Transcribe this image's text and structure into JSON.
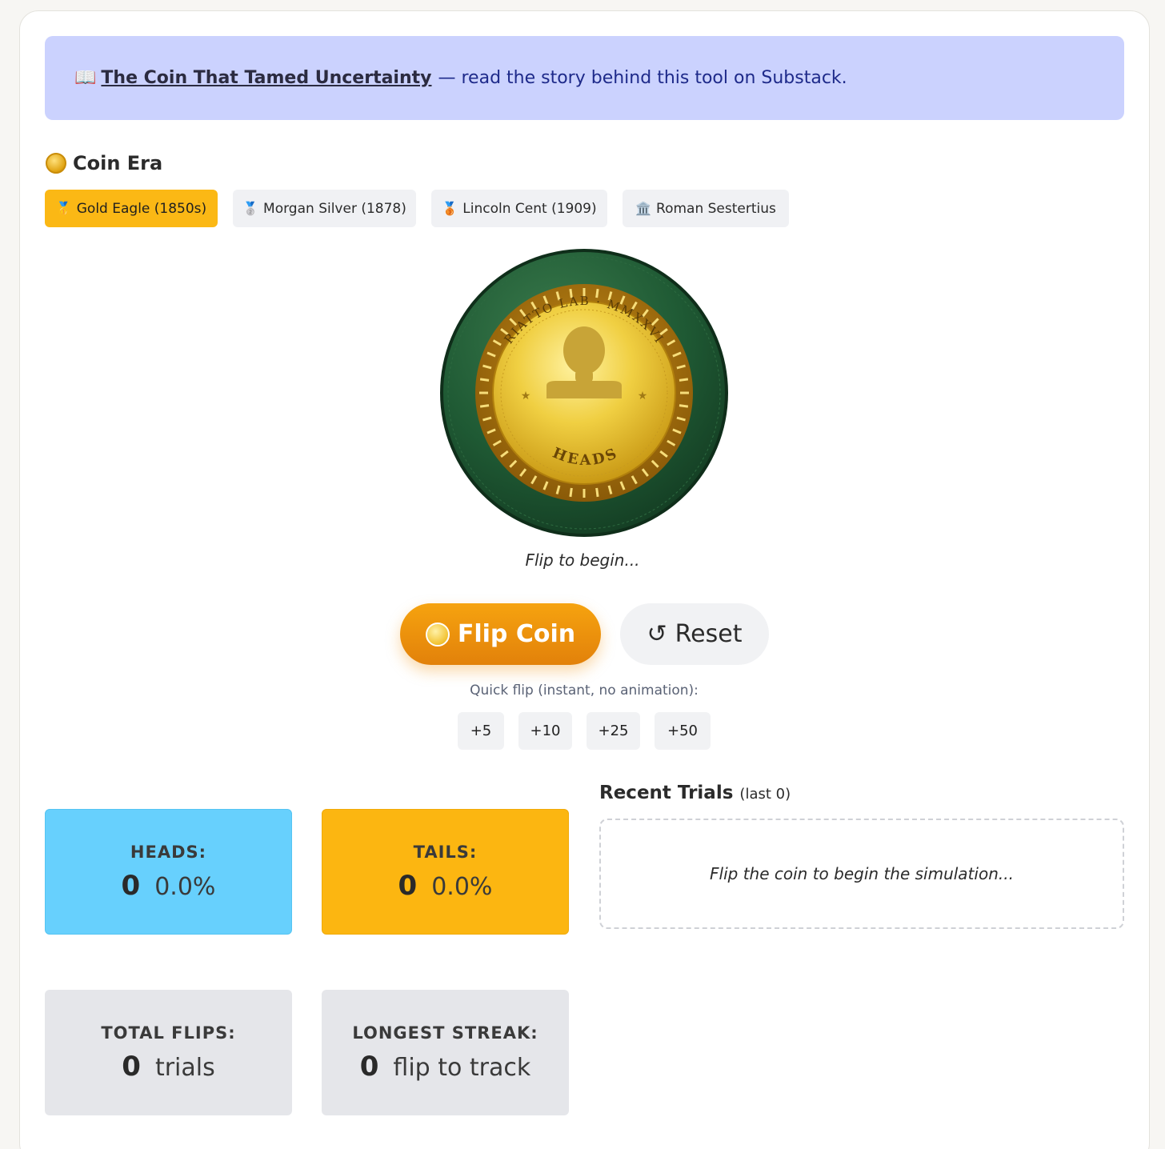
{
  "banner": {
    "book_icon": "📖",
    "link_text": "The Coin That Tamed Uncertainty",
    "rest_text": "— read the story behind this tool on Substack."
  },
  "era": {
    "title": "Coin Era",
    "options": [
      {
        "label": "Gold Eagle (1850s)",
        "medal": "🥇",
        "active": true
      },
      {
        "label": "Morgan Silver (1878)",
        "medal": "🥈",
        "active": false
      },
      {
        "label": "Lincoln Cent (1909)",
        "medal": "🥉",
        "active": false
      },
      {
        "label": "Roman Sestertius",
        "medal": "🏛️",
        "active": false
      }
    ]
  },
  "coin": {
    "rim_text": "RIATTO LAB · MMXXVI",
    "face_text": "HEADS",
    "caption": "Flip to begin...",
    "colors": {
      "felt": "#1f5a34",
      "gold": "#e6c23a",
      "rim": "#9c6a0c"
    }
  },
  "controls": {
    "flip_label": "Flip Coin",
    "reset_icon": "↺",
    "reset_label": "Reset",
    "quick_label": "Quick flip (instant, no animation):",
    "quick": [
      "+5",
      "+10",
      "+25",
      "+50"
    ]
  },
  "stats": {
    "heads": {
      "label": "HEADS:",
      "count": "0",
      "pct": "0.0%"
    },
    "tails": {
      "label": "TAILS:",
      "count": "0",
      "pct": "0.0%"
    },
    "total": {
      "label": "TOTAL FLIPS:",
      "count": "0",
      "sub": "trials"
    },
    "streak": {
      "label": "LONGEST STREAK:",
      "count": "0",
      "sub": "flip to track"
    }
  },
  "recent": {
    "title": "Recent Trials",
    "count_text": "(last 0)",
    "empty_text": "Flip the coin to begin the simulation..."
  }
}
